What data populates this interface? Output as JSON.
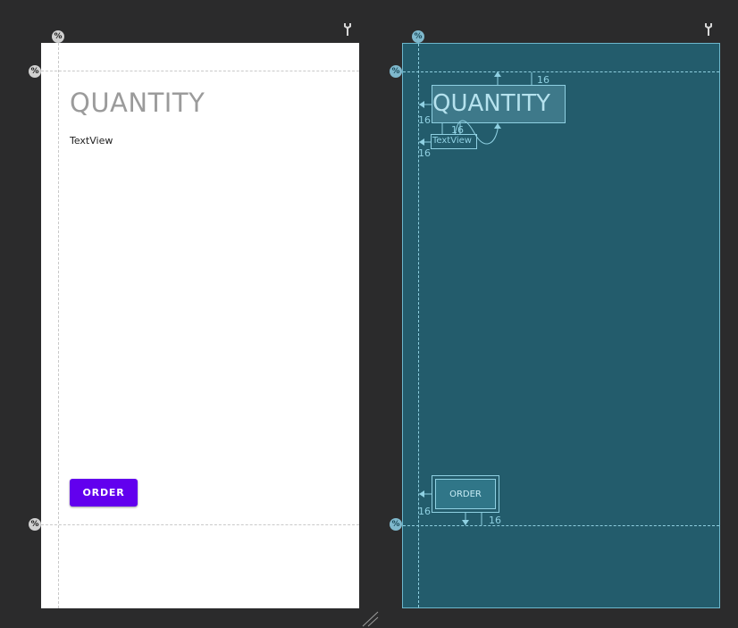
{
  "design": {
    "title": "QUANTITY",
    "textview": "TextView",
    "order_button": "ORDER",
    "percent_symbol": "%"
  },
  "blueprint": {
    "title": "QUANTITY",
    "textview": "TextView",
    "order_button": "ORDER",
    "percent_symbol": "%",
    "margin_labels": [
      "16",
      "16",
      "16",
      "16",
      "16",
      "16"
    ]
  },
  "colors": {
    "canvas": "#2b2b2c",
    "button": "#6200ee",
    "blueprint_bg": "#235c6c",
    "blueprint_line": "#8fd0e2"
  },
  "icons": [
    "percent-icon",
    "wrench-icon",
    "resize-handle-icon",
    "arrow-icon"
  ]
}
